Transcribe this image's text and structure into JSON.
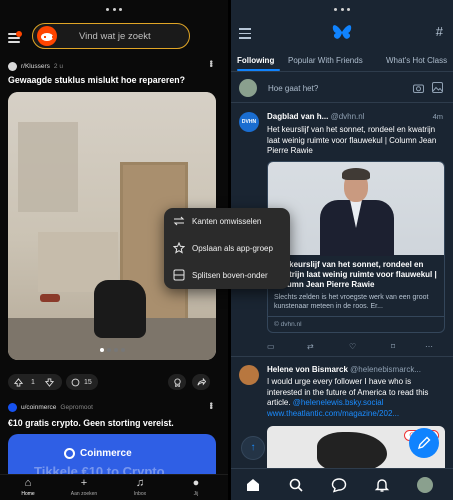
{
  "reddit": {
    "search_placeholder": "Vind wat je zoekt",
    "post1": {
      "subreddit": "r/Klussers",
      "age": "2 u",
      "title": "Gewaagde stuklus mislukt hoe repareren?",
      "upvotes": "1",
      "comments": "15"
    },
    "post2": {
      "account": "u/coinmerce",
      "sponsored": "Gepromoot",
      "title": "€10 gratis crypto. Geen storting vereist.",
      "brand": "Coinmerce",
      "faded_text": "Tikkele €10 to Crypto"
    },
    "nav": [
      "Home",
      "Aan zoeken",
      "Inbox",
      "Jij"
    ]
  },
  "context_menu": {
    "items": [
      "Kanten omwisselen",
      "Opslaan als app-groep",
      "Splitsen boven-onder"
    ]
  },
  "bluesky": {
    "tabs": [
      "Following",
      "Popular With Friends",
      "What's Hot Class"
    ],
    "compose_placeholder": "Hoe gaat het?",
    "post1": {
      "name": "Dagblad van h...",
      "handle": "@dvhn.nl",
      "time": "4m",
      "text": "Het keurslijf van het sonnet, rondeel en kwatrijn laat weinig ruimte voor flauwekul | Column Jean Pierre Rawie",
      "avatar_text": "DVHN",
      "card_title": "Het keurslijf van het sonnet, rondeel en kwatrijn laat weinig ruimte voor flauwekul | Column Jean Pierre Rawie",
      "card_desc": "Slechts zelden is het vroegste werk van een groot kunstenaar meteen in de roos. Er...",
      "card_source": "© dvhn.nl"
    },
    "post2": {
      "name": "Helene von Bismarck",
      "handle": "@helenebismarck...",
      "time": "4m",
      "text": "I would urge every follower I have who is interested in the future of America to read this article.",
      "link1": "@helenelewis.bsky.social",
      "link2": "www.theatlantic.com/magazine/202...",
      "image_tag": "Ontvang"
    }
  },
  "colors": {
    "reddit_orange": "#ff4500",
    "search_border": "#e0a526",
    "bluesky_blue": "#1083fe",
    "bluesky_bg": "#1a2532"
  }
}
